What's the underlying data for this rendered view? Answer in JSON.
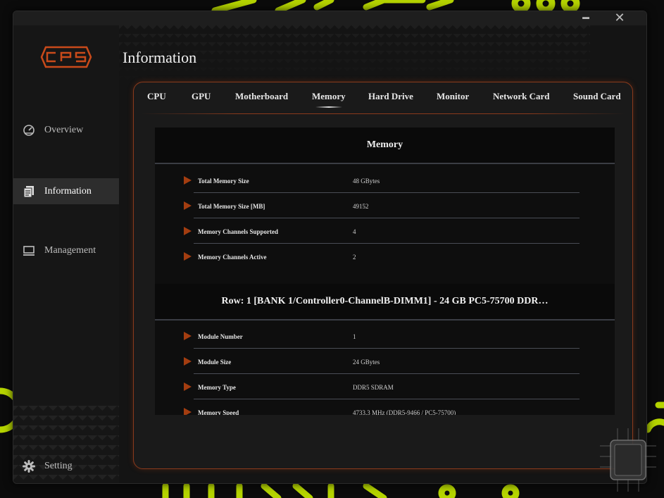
{
  "window": {
    "minimize_label": "━",
    "close_label": "✕"
  },
  "brand": {
    "logo_text": "CPS",
    "accent_color": "#c94a1a",
    "decor_color": "#b5d400"
  },
  "sidebar": {
    "items": [
      {
        "label": "Overview",
        "icon": "speedometer-icon"
      },
      {
        "label": "Information",
        "icon": "document-icon",
        "active": true
      },
      {
        "label": "Management",
        "icon": "monitor-icon"
      },
      {
        "label": "Setting",
        "icon": "gear-icon"
      }
    ]
  },
  "header": {
    "title": "Information"
  },
  "tabs": [
    {
      "label": "CPU"
    },
    {
      "label": "GPU"
    },
    {
      "label": "Motherboard"
    },
    {
      "label": "Memory",
      "active": true
    },
    {
      "label": "Hard Drive"
    },
    {
      "label": "Monitor"
    },
    {
      "label": "Network Card"
    },
    {
      "label": "Sound Card"
    }
  ],
  "memory": {
    "title": "Memory",
    "rows": [
      {
        "key": "Total Memory Size",
        "value": "48 GBytes"
      },
      {
        "key": "Total Memory Size [MB]",
        "value": "49152"
      },
      {
        "key": "Memory Channels Supported",
        "value": "4"
      },
      {
        "key": "Memory Channels Active",
        "value": "2"
      }
    ]
  },
  "module": {
    "title": "Row: 1 [BANK 1/Controller0-ChannelB-DIMM1] - 24 GB PC5-75700 DDR…",
    "rows": [
      {
        "key": "Module Number",
        "value": "1"
      },
      {
        "key": "Module Size",
        "value": "24 GBytes"
      },
      {
        "key": "Memory Type",
        "value": "DDR5 SDRAM"
      },
      {
        "key": "Memory Speed",
        "value": "4733.3 MHz (DDR5-9466 / PC5-75700)"
      }
    ]
  }
}
